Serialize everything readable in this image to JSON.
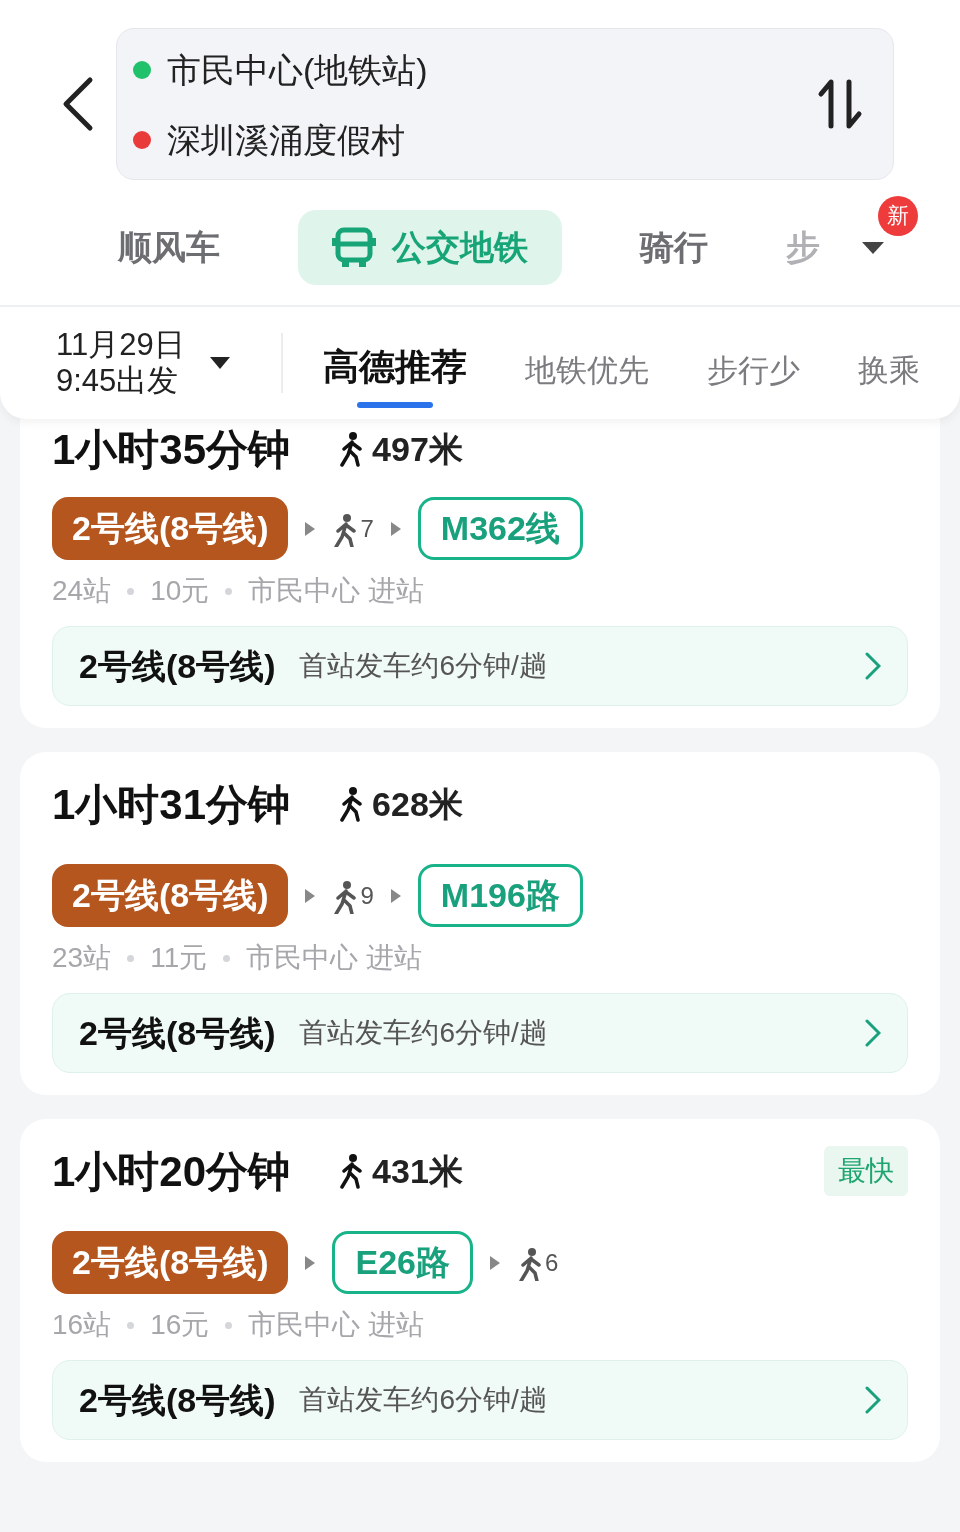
{
  "route": {
    "origin": "市民中心(地铁站)",
    "destination": "深圳溪涌度假村"
  },
  "mode_tabs": [
    {
      "label": "顺风车",
      "selected": false,
      "kind": "text"
    },
    {
      "label": "公交地铁",
      "selected": true,
      "kind": "bus"
    },
    {
      "label": "骑行",
      "selected": false,
      "kind": "text"
    },
    {
      "label": "步",
      "selected": false,
      "kind": "text"
    }
  ],
  "more_badge": "新",
  "departure": {
    "date": "11月29日",
    "time": "9:45出发"
  },
  "sort_tabs": [
    {
      "label": "高德推荐",
      "selected": true
    },
    {
      "label": "地铁优先",
      "selected": false
    },
    {
      "label": "步行少",
      "selected": false
    },
    {
      "label": "换乘",
      "selected": false
    }
  ],
  "plans": [
    {
      "duration": "1小时35分钟",
      "walk": "497米",
      "segments": [
        {
          "kind": "metro",
          "label": "2号线(8号线)"
        },
        {
          "kind": "walk",
          "label": "7"
        },
        {
          "kind": "bus",
          "label": "M362线"
        }
      ],
      "stops": "24站",
      "fare": "10元",
      "entry": "市民中心 进站",
      "detail_line": "2号线(8号线)",
      "detail_info": "首站发车约6分钟/趟"
    },
    {
      "duration": "1小时31分钟",
      "walk": "628米",
      "segments": [
        {
          "kind": "metro",
          "label": "2号线(8号线)"
        },
        {
          "kind": "walk",
          "label": "9"
        },
        {
          "kind": "bus",
          "label": "M196路"
        }
      ],
      "stops": "23站",
      "fare": "11元",
      "entry": "市民中心 进站",
      "detail_line": "2号线(8号线)",
      "detail_info": "首站发车约6分钟/趟"
    },
    {
      "duration": "1小时20分钟",
      "walk": "431米",
      "tag": "最快",
      "segments": [
        {
          "kind": "metro",
          "label": "2号线(8号线)"
        },
        {
          "kind": "bus",
          "label": "E26路"
        },
        {
          "kind": "walk",
          "label": "6"
        }
      ],
      "stops": "16站",
      "fare": "16元",
      "entry": "市民中心 进站",
      "detail_line": "2号线(8号线)",
      "detail_info": "首站发车约6分钟/趟"
    }
  ]
}
